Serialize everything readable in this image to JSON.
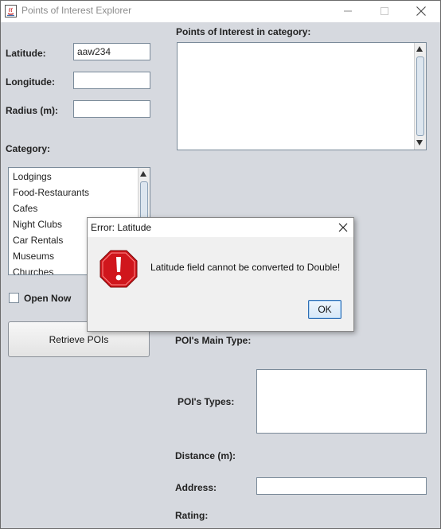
{
  "window": {
    "title": "Points of Interest Explorer"
  },
  "form": {
    "latitude_label": "Latitude:",
    "latitude_value": "aaw234",
    "longitude_label": "Longitude:",
    "longitude_value": "",
    "radius_label": "Radius (m):",
    "radius_value": "",
    "category_label": "Category:",
    "categories": [
      "Lodgings",
      "Food-Restaurants",
      "Cafes",
      "Night Clubs",
      "Car Rentals",
      "Museums",
      "Churches"
    ],
    "open_now_label": "Open Now",
    "open_now_checked": false,
    "retrieve_label": "Retrieve POIs"
  },
  "results": {
    "poi_list_label": "Points of Interest in category:",
    "main_type_label": "POI's Main Type:",
    "types_label": "POI's Types:",
    "distance_label": "Distance (m):",
    "address_label": "Address:",
    "address_value": "",
    "rating_label": "Rating:"
  },
  "dialog": {
    "title": "Error: Latitude",
    "message": "Latitude field cannot be converted to Double!",
    "ok_label": "OK",
    "icon": "error-icon"
  },
  "colors": {
    "window_bg": "#d6d9df",
    "error_red": "#d0161c",
    "ok_border": "#2f6fb5"
  }
}
